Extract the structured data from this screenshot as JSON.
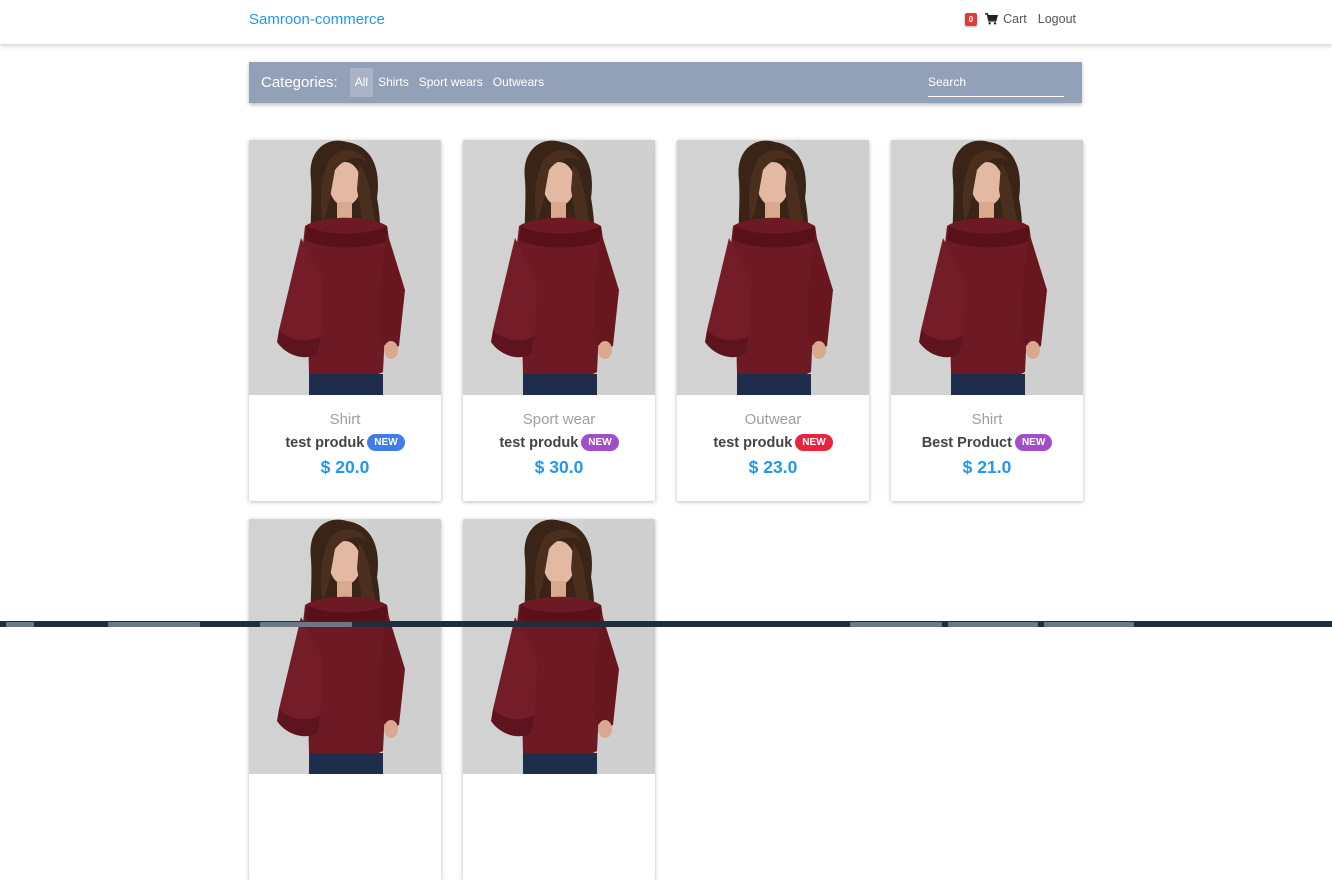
{
  "navbar": {
    "brand": "Samroon-commerce",
    "cart_count": "0",
    "cart_label": "Cart",
    "cart_icon": "shopping-cart-icon",
    "logout_label": "Logout"
  },
  "categories": {
    "title": "Categories:",
    "items": [
      "All",
      "Shirts",
      "Sport wears",
      "Outwears"
    ],
    "active": "All",
    "search_placeholder": "Search"
  },
  "products": [
    {
      "category": "Shirt",
      "name": "test produk",
      "badge": "NEW",
      "badge_color": "#3f7ee8",
      "price": "$ 20.0"
    },
    {
      "category": "Sport wear",
      "name": "test produk",
      "badge": "NEW",
      "badge_color": "#a24ec7",
      "price": "$ 30.0"
    },
    {
      "category": "Outwear",
      "name": "test produk",
      "badge": "NEW",
      "badge_color": "#e8253f",
      "price": "$ 23.0"
    },
    {
      "category": "Shirt",
      "name": "Best Product",
      "badge": "NEW",
      "badge_color": "#a24ec7",
      "price": "$ 21.0"
    },
    {
      "category": "",
      "name": "",
      "badge": "",
      "badge_color": "",
      "price": ""
    },
    {
      "category": "",
      "name": "",
      "badge": "",
      "badge_color": "",
      "price": ""
    }
  ],
  "colors": {
    "accent": "#2196f3",
    "category_bar": "#93a1b8",
    "garment": "#6d1a24",
    "cart_badge": "#e53935"
  }
}
